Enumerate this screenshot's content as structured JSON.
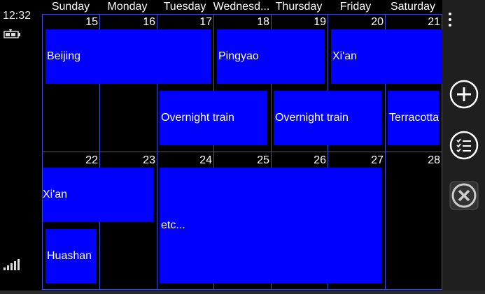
{
  "status": {
    "time": "12:32"
  },
  "calendar": {
    "days": [
      "Sunday",
      "Monday",
      "Tuesday",
      "Wednesd...",
      "Thursday",
      "Friday",
      "Saturday"
    ],
    "week1_dates": [
      "15",
      "16",
      "17",
      "18",
      "19",
      "20",
      "21"
    ],
    "week2_dates": [
      "22",
      "23",
      "24",
      "25",
      "26",
      "27",
      "28"
    ],
    "events": {
      "beijing": "Beijing",
      "pingyao": "Pingyao",
      "xian1": "Xi'an",
      "train1": "Overnight train",
      "train2": "Overnight train",
      "terracotta": "Terracotta",
      "xian2": "Xi'an",
      "huashan": "Huashan",
      "etc": "etc..."
    }
  },
  "appbar": {
    "buttons": [
      "add-icon",
      "list-icon",
      "close-icon"
    ]
  },
  "colors": {
    "event": "#0000ff",
    "grid": "#3a4fd0",
    "background": "#000000",
    "appbar": "#1f1f1f"
  }
}
